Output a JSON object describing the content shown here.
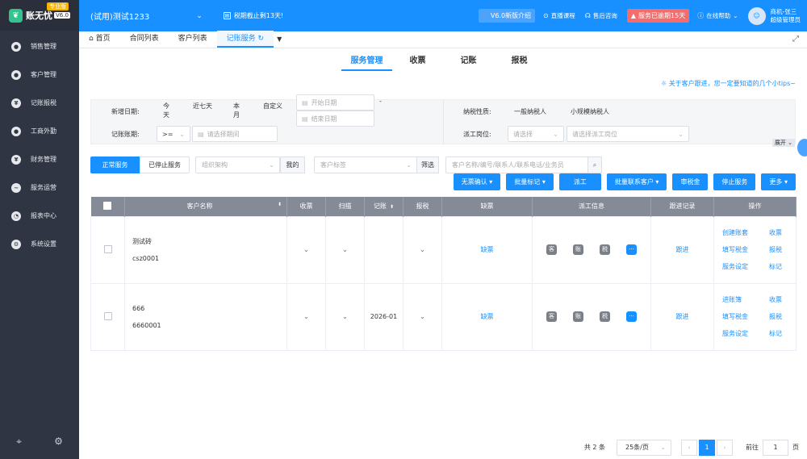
{
  "app": {
    "name": "账无忧",
    "version": "V6.0",
    "edition": "专业版"
  },
  "sidebar": {
    "items": [
      {
        "label": "销售管理",
        "icon": "sales-icon",
        "glyph": "●"
      },
      {
        "label": "客户管理",
        "icon": "customer-icon",
        "glyph": "●"
      },
      {
        "label": "记账报税",
        "icon": "tax-icon",
        "glyph": "¥"
      },
      {
        "label": "工商外勤",
        "icon": "field-service-icon",
        "glyph": "●"
      },
      {
        "label": "财务管理",
        "icon": "finance-icon",
        "glyph": "¥"
      },
      {
        "label": "服务运营",
        "icon": "operations-icon",
        "glyph": "~"
      },
      {
        "label": "报表中心",
        "icon": "report-icon",
        "glyph": "◔"
      },
      {
        "label": "系统设置",
        "icon": "settings-icon",
        "glyph": "⚙"
      }
    ]
  },
  "topbar": {
    "company": "(试用)测试1233",
    "deadline": "税期截止剩13天!",
    "new_version": "V6.0新版介绍",
    "live": "直播课程",
    "after_sales": "售后咨询",
    "expired": "服务已逾期15天",
    "help": "在线帮助",
    "user_name": "商机-张三",
    "user_role": "超级管理员"
  },
  "page_tabs": [
    "首页",
    "合同列表",
    "客户列表",
    "记账服务"
  ],
  "sub_tabs": [
    "服务管理",
    "收票",
    "记账",
    "报税"
  ],
  "tip": "关于客户跟进，您一定要知道的几个小tips~",
  "filter": {
    "add_date_label": "新增日期:",
    "date_options": [
      "今天",
      "近七天",
      "本月",
      "自定义"
    ],
    "start_date": "开始日期",
    "end_date": "结束日期",
    "dash": "-",
    "period_label": "记账账期:",
    "period_op": ">=",
    "period_placeholder": "请选择期间",
    "taxpayer_label": "纳税性质:",
    "taxpayer_options": [
      "一般纳税人",
      "小规模纳税人"
    ],
    "dispatch_label": "派工岗位:",
    "dispatch_select": "请选择",
    "dispatch_staff": "请选择派工岗位",
    "expand": "展开"
  },
  "toolbar": {
    "normal": "正常服务",
    "stopped": "已停止服务",
    "org": "组织架构",
    "mine": "我的",
    "tag": "客户标签",
    "screen": "筛选",
    "search_placeholder": "客户名称/编号/联系人/联系电话/业务员"
  },
  "actions": [
    "无票确认",
    "批量标记",
    "派工",
    "批量联系客户",
    "审税金",
    "停止服务",
    "更多"
  ],
  "table": {
    "headers": [
      "客户名称",
      "收票",
      "扫描",
      "记账",
      "报税",
      "缺票",
      "派工信息",
      "跟进记录",
      "操作"
    ],
    "rows": [
      {
        "name": "测试砖",
        "code": "csz0001",
        "bookkeeping": "",
        "missing": "缺票",
        "tags": [
          "客",
          "账",
          "税",
          "···"
        ],
        "follow": "跟进",
        "ops": [
          "创建账套",
          "收票",
          "填写税金",
          "报税",
          "服务设定",
          "标记"
        ]
      },
      {
        "name": "666",
        "code": "6660001",
        "bookkeeping": "2026-01",
        "missing": "缺票",
        "tags": [
          "客",
          "账",
          "税",
          "···"
        ],
        "follow": "跟进",
        "ops": [
          "进账簿",
          "收票",
          "填写税金",
          "报税",
          "服务设定",
          "标记"
        ]
      }
    ]
  },
  "pager": {
    "total": "共 2 条",
    "size": "25条/页",
    "current": "1",
    "goto_label": "前往",
    "goto_value": "1",
    "page_suffix": "页"
  },
  "colors": {
    "primary": "#1890ff",
    "sidebar": "#2f3542",
    "danger": "#f56c6c"
  }
}
